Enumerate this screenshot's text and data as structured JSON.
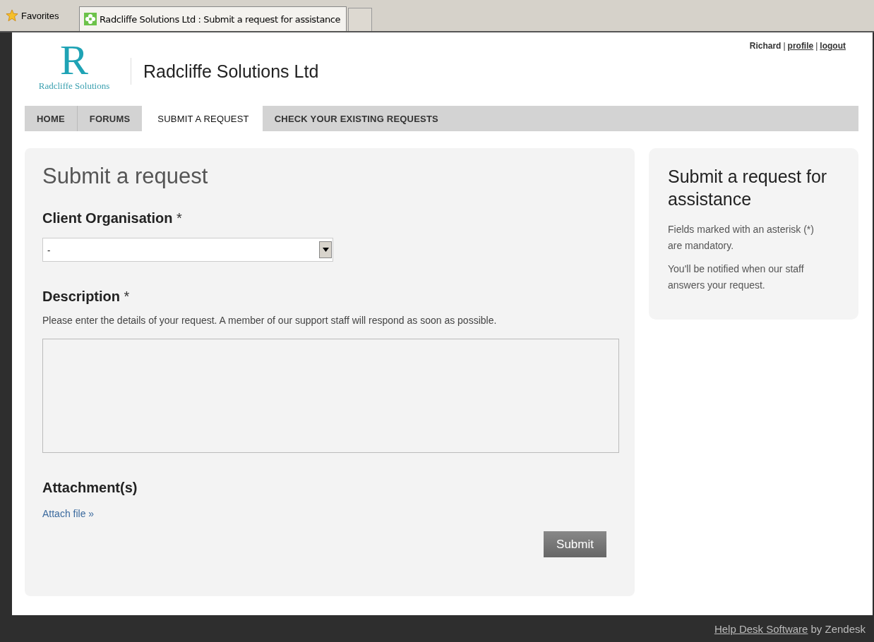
{
  "browser": {
    "favorites": "Favorites",
    "tabs": [
      {
        "label": "Radcliffe Solutions Ltd : Submit a request for assistance",
        "selected": true
      }
    ]
  },
  "header": {
    "logo_letter": "R",
    "logo_text": "Radcliffe Solutions",
    "site_title": "Radcliffe Solutions Ltd",
    "user_bar": [
      {
        "kind": "name",
        "text": "Richard"
      },
      {
        "kind": "separator",
        "text": "|"
      },
      {
        "kind": "link",
        "text": "profile"
      },
      {
        "kind": "separator",
        "text": "|"
      },
      {
        "kind": "link",
        "text": "logout"
      }
    ]
  },
  "nav": [
    {
      "label": "HOME",
      "selected": false
    },
    {
      "label": "FORUMS",
      "selected": false
    },
    {
      "label": "SUBMIT A REQUEST",
      "selected": true
    },
    {
      "label": "CHECK YOUR EXISTING REQUESTS",
      "selected": false
    }
  ],
  "form": {
    "title": "Submit a request",
    "fields": [
      {
        "kind": "select",
        "label": "**Client Organisation** *",
        "value": "-"
      },
      {
        "kind": "textarea",
        "label": "**Description** *",
        "hint": "Please enter the details of your request. A member of our support staff will respond as soon as possible."
      },
      {
        "kind": "attach",
        "label": "**Attachment(s)**",
        "link": "Attach file »"
      }
    ],
    "submit": "Submit"
  },
  "sidebar": {
    "title": "Submit a request for assistance",
    "paragraphs": [
      "Fields marked with an asterisk (*) are mandatory.",
      "You'll be notified when our staff answers your request."
    ]
  },
  "footer": {
    "link": "Help Desk Software",
    "text": "by Zendesk"
  }
}
